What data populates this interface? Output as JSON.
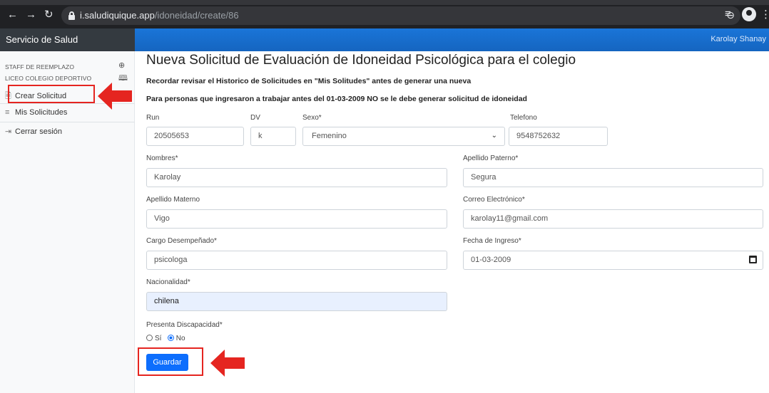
{
  "browser": {
    "url_host": "i.saludiquique.app",
    "url_path": "/idoneidad/create/86"
  },
  "app": {
    "brand": "Servicio de Salud",
    "user": "Karolay Shanay"
  },
  "sidebar": {
    "section1": "STAFF DE REEMPLAZO",
    "section2": "LICEO COLEGIO DEPORTIVO",
    "items": [
      {
        "label": "Crear Solicitud",
        "icon": "file-icon"
      },
      {
        "label": "Mis Solicitudes",
        "icon": "list-icon"
      },
      {
        "label": "Cerrar sesión",
        "icon": "logout-icon"
      }
    ]
  },
  "form": {
    "title": "Nueva Solicitud de Evaluación de Idoneidad Psicológica para el colegio",
    "note1": "Recordar revisar el Historico de Solicitudes en \"Mis Solitudes\" antes de generar una nueva",
    "note2": "Para personas que ingresaron a trabajar antes del 01-03-2009 NO se le debe generar solicitud de idoneidad",
    "run": {
      "label": "Run",
      "value": "20505653"
    },
    "dv": {
      "label": "DV",
      "value": "k"
    },
    "sexo": {
      "label": "Sexo*",
      "value": "Femenino"
    },
    "telefono": {
      "label": "Telefono",
      "value": "9548752632"
    },
    "nombres": {
      "label": "Nombres*",
      "value": "Karolay"
    },
    "apellido_paterno": {
      "label": "Apellido Paterno*",
      "value": "Segura"
    },
    "apellido_materno": {
      "label": "Apellido Materno",
      "value": "Vigo"
    },
    "correo": {
      "label": "Correo Electrónico*",
      "value": "karolay11@gmail.com"
    },
    "cargo": {
      "label": "Cargo Desempeñado*",
      "value": "psicologa"
    },
    "fecha_ingreso": {
      "label": "Fecha de Ingreso*",
      "value": "01-03-2009"
    },
    "nacionalidad": {
      "label": "Nacionalidad*",
      "value": "chilena"
    },
    "discapacidad": {
      "label": "Presenta Discapacidad*",
      "opt_yes": "Sí",
      "opt_no": "No",
      "selected": "No"
    },
    "submit": "Guardar"
  },
  "colors": {
    "accent": "#0d6efd",
    "highlight": "#e52520",
    "sidebar_bg": "#f8f9fa",
    "brand_bg": "#343a40"
  }
}
